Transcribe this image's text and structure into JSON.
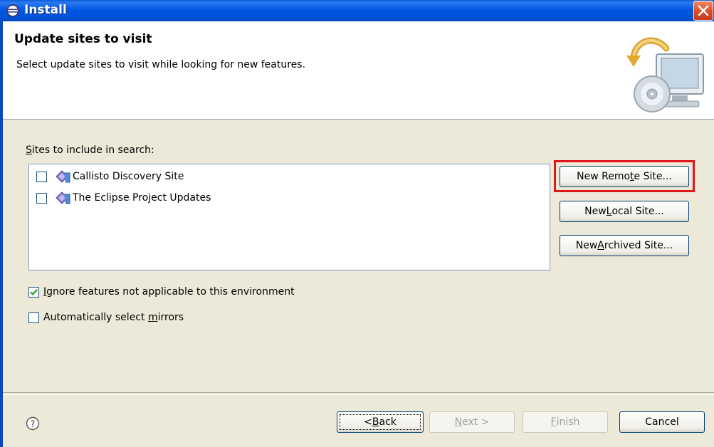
{
  "window": {
    "title": "Install"
  },
  "header": {
    "title": "Update sites to visit",
    "description": "Select update sites to visit while looking for new features."
  },
  "sites": {
    "label_prefix": "S",
    "label_rest": "ites to include in search:",
    "items": [
      {
        "label": "Callisto Discovery Site",
        "checked": false
      },
      {
        "label": "The Eclipse Project Updates",
        "checked": false
      }
    ]
  },
  "side_buttons": {
    "remote": {
      "pre": "New Remo",
      "acc": "t",
      "post": "e Site..."
    },
    "local": {
      "pre": "New ",
      "acc": "L",
      "post": "ocal Site..."
    },
    "archived": {
      "pre": "New ",
      "acc": "A",
      "post": "rchived Site..."
    }
  },
  "options": {
    "ignore": {
      "acc": "I",
      "rest": "gnore features not applicable to this environment",
      "checked": true
    },
    "mirrors": {
      "pre": "Automatically select ",
      "acc": "m",
      "post": "irrors",
      "checked": false
    }
  },
  "footer": {
    "back": {
      "pre": "< ",
      "acc": "B",
      "post": "ack"
    },
    "next": {
      "acc": "N",
      "post": "ext >"
    },
    "finish": {
      "acc": "F",
      "post": "inish"
    },
    "cancel": "Cancel"
  },
  "colors": {
    "title_bar": "#0058e6",
    "highlight": "#e0161c",
    "dialog_bg": "#ece9d8"
  }
}
